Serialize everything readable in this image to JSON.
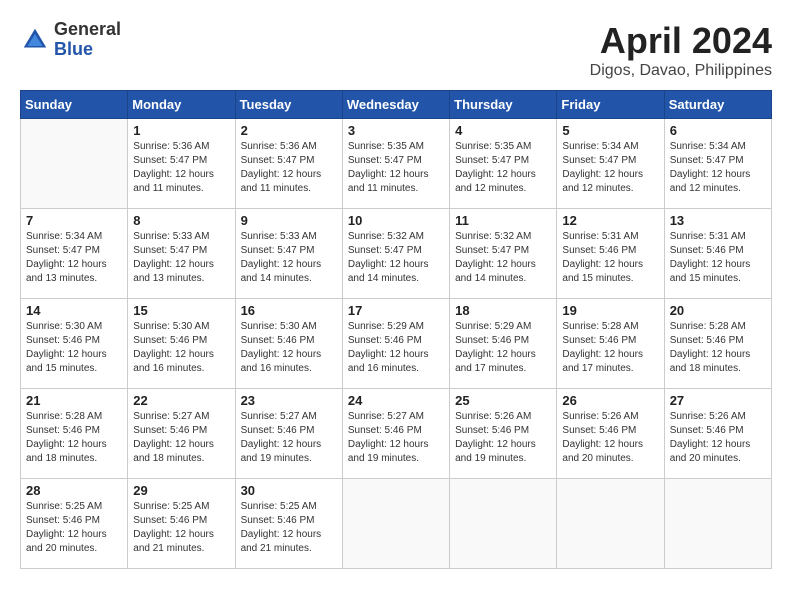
{
  "header": {
    "logo_general": "General",
    "logo_blue": "Blue",
    "month_title": "April 2024",
    "location": "Digos, Davao, Philippines"
  },
  "weekdays": [
    "Sunday",
    "Monday",
    "Tuesday",
    "Wednesday",
    "Thursday",
    "Friday",
    "Saturday"
  ],
  "weeks": [
    [
      {
        "day": "",
        "info": ""
      },
      {
        "day": "1",
        "info": "Sunrise: 5:36 AM\nSunset: 5:47 PM\nDaylight: 12 hours\nand 11 minutes."
      },
      {
        "day": "2",
        "info": "Sunrise: 5:36 AM\nSunset: 5:47 PM\nDaylight: 12 hours\nand 11 minutes."
      },
      {
        "day": "3",
        "info": "Sunrise: 5:35 AM\nSunset: 5:47 PM\nDaylight: 12 hours\nand 11 minutes."
      },
      {
        "day": "4",
        "info": "Sunrise: 5:35 AM\nSunset: 5:47 PM\nDaylight: 12 hours\nand 12 minutes."
      },
      {
        "day": "5",
        "info": "Sunrise: 5:34 AM\nSunset: 5:47 PM\nDaylight: 12 hours\nand 12 minutes."
      },
      {
        "day": "6",
        "info": "Sunrise: 5:34 AM\nSunset: 5:47 PM\nDaylight: 12 hours\nand 12 minutes."
      }
    ],
    [
      {
        "day": "7",
        "info": "Sunrise: 5:34 AM\nSunset: 5:47 PM\nDaylight: 12 hours\nand 13 minutes."
      },
      {
        "day": "8",
        "info": "Sunrise: 5:33 AM\nSunset: 5:47 PM\nDaylight: 12 hours\nand 13 minutes."
      },
      {
        "day": "9",
        "info": "Sunrise: 5:33 AM\nSunset: 5:47 PM\nDaylight: 12 hours\nand 14 minutes."
      },
      {
        "day": "10",
        "info": "Sunrise: 5:32 AM\nSunset: 5:47 PM\nDaylight: 12 hours\nand 14 minutes."
      },
      {
        "day": "11",
        "info": "Sunrise: 5:32 AM\nSunset: 5:47 PM\nDaylight: 12 hours\nand 14 minutes."
      },
      {
        "day": "12",
        "info": "Sunrise: 5:31 AM\nSunset: 5:46 PM\nDaylight: 12 hours\nand 15 minutes."
      },
      {
        "day": "13",
        "info": "Sunrise: 5:31 AM\nSunset: 5:46 PM\nDaylight: 12 hours\nand 15 minutes."
      }
    ],
    [
      {
        "day": "14",
        "info": "Sunrise: 5:30 AM\nSunset: 5:46 PM\nDaylight: 12 hours\nand 15 minutes."
      },
      {
        "day": "15",
        "info": "Sunrise: 5:30 AM\nSunset: 5:46 PM\nDaylight: 12 hours\nand 16 minutes."
      },
      {
        "day": "16",
        "info": "Sunrise: 5:30 AM\nSunset: 5:46 PM\nDaylight: 12 hours\nand 16 minutes."
      },
      {
        "day": "17",
        "info": "Sunrise: 5:29 AM\nSunset: 5:46 PM\nDaylight: 12 hours\nand 16 minutes."
      },
      {
        "day": "18",
        "info": "Sunrise: 5:29 AM\nSunset: 5:46 PM\nDaylight: 12 hours\nand 17 minutes."
      },
      {
        "day": "19",
        "info": "Sunrise: 5:28 AM\nSunset: 5:46 PM\nDaylight: 12 hours\nand 17 minutes."
      },
      {
        "day": "20",
        "info": "Sunrise: 5:28 AM\nSunset: 5:46 PM\nDaylight: 12 hours\nand 18 minutes."
      }
    ],
    [
      {
        "day": "21",
        "info": "Sunrise: 5:28 AM\nSunset: 5:46 PM\nDaylight: 12 hours\nand 18 minutes."
      },
      {
        "day": "22",
        "info": "Sunrise: 5:27 AM\nSunset: 5:46 PM\nDaylight: 12 hours\nand 18 minutes."
      },
      {
        "day": "23",
        "info": "Sunrise: 5:27 AM\nSunset: 5:46 PM\nDaylight: 12 hours\nand 19 minutes."
      },
      {
        "day": "24",
        "info": "Sunrise: 5:27 AM\nSunset: 5:46 PM\nDaylight: 12 hours\nand 19 minutes."
      },
      {
        "day": "25",
        "info": "Sunrise: 5:26 AM\nSunset: 5:46 PM\nDaylight: 12 hours\nand 19 minutes."
      },
      {
        "day": "26",
        "info": "Sunrise: 5:26 AM\nSunset: 5:46 PM\nDaylight: 12 hours\nand 20 minutes."
      },
      {
        "day": "27",
        "info": "Sunrise: 5:26 AM\nSunset: 5:46 PM\nDaylight: 12 hours\nand 20 minutes."
      }
    ],
    [
      {
        "day": "28",
        "info": "Sunrise: 5:25 AM\nSunset: 5:46 PM\nDaylight: 12 hours\nand 20 minutes."
      },
      {
        "day": "29",
        "info": "Sunrise: 5:25 AM\nSunset: 5:46 PM\nDaylight: 12 hours\nand 21 minutes."
      },
      {
        "day": "30",
        "info": "Sunrise: 5:25 AM\nSunset: 5:46 PM\nDaylight: 12 hours\nand 21 minutes."
      },
      {
        "day": "",
        "info": ""
      },
      {
        "day": "",
        "info": ""
      },
      {
        "day": "",
        "info": ""
      },
      {
        "day": "",
        "info": ""
      }
    ]
  ]
}
